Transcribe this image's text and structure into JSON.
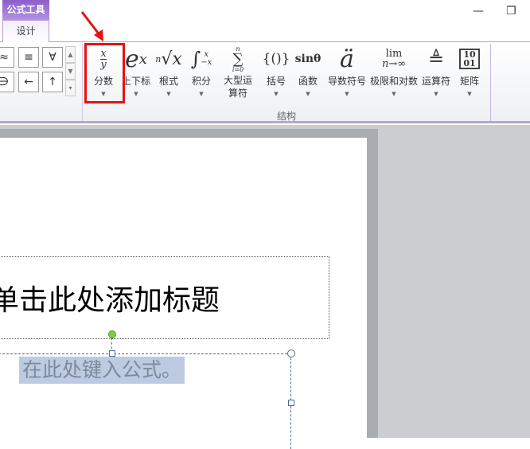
{
  "contextual_tab": "公式工具",
  "tab": "设计",
  "window": {
    "minimize": "—",
    "restore": "❐"
  },
  "symbols": {
    "row1": [
      "≈",
      "≡",
      "∀"
    ],
    "row2": [
      "∋",
      "←",
      "↑"
    ],
    "scroll": [
      "▲",
      "▼",
      "▾"
    ]
  },
  "structures": [
    {
      "id": "fraction",
      "icon": "x/y",
      "label": "分数"
    },
    {
      "id": "script",
      "icon": "eˣ",
      "label": "上下标"
    },
    {
      "id": "radical",
      "icon": "ⁿ√x",
      "label": "根式"
    },
    {
      "id": "integral",
      "icon": "∫",
      "label": "积分"
    },
    {
      "id": "large-operator",
      "icon": "∑",
      "label": "大型运算符"
    },
    {
      "id": "bracket",
      "icon": "{()}",
      "label": "括号"
    },
    {
      "id": "function",
      "icon": "sinθ",
      "label": "函数"
    },
    {
      "id": "accent",
      "icon": "ä",
      "label": "导数符号"
    },
    {
      "id": "limit-log",
      "icon": "lim",
      "label": "极限和对数"
    },
    {
      "id": "operator",
      "icon": "≜",
      "label": "运算符"
    },
    {
      "id": "matrix",
      "icon": "[10;01]",
      "label": "矩阵"
    }
  ],
  "group_label": "结构",
  "slide": {
    "title_placeholder": "单击此处添加标题",
    "equation_placeholder": "在此处键入公式。"
  },
  "colors": {
    "accent": "#8a5fc9",
    "highlight": "#e31313",
    "arrow": "#e31313"
  }
}
